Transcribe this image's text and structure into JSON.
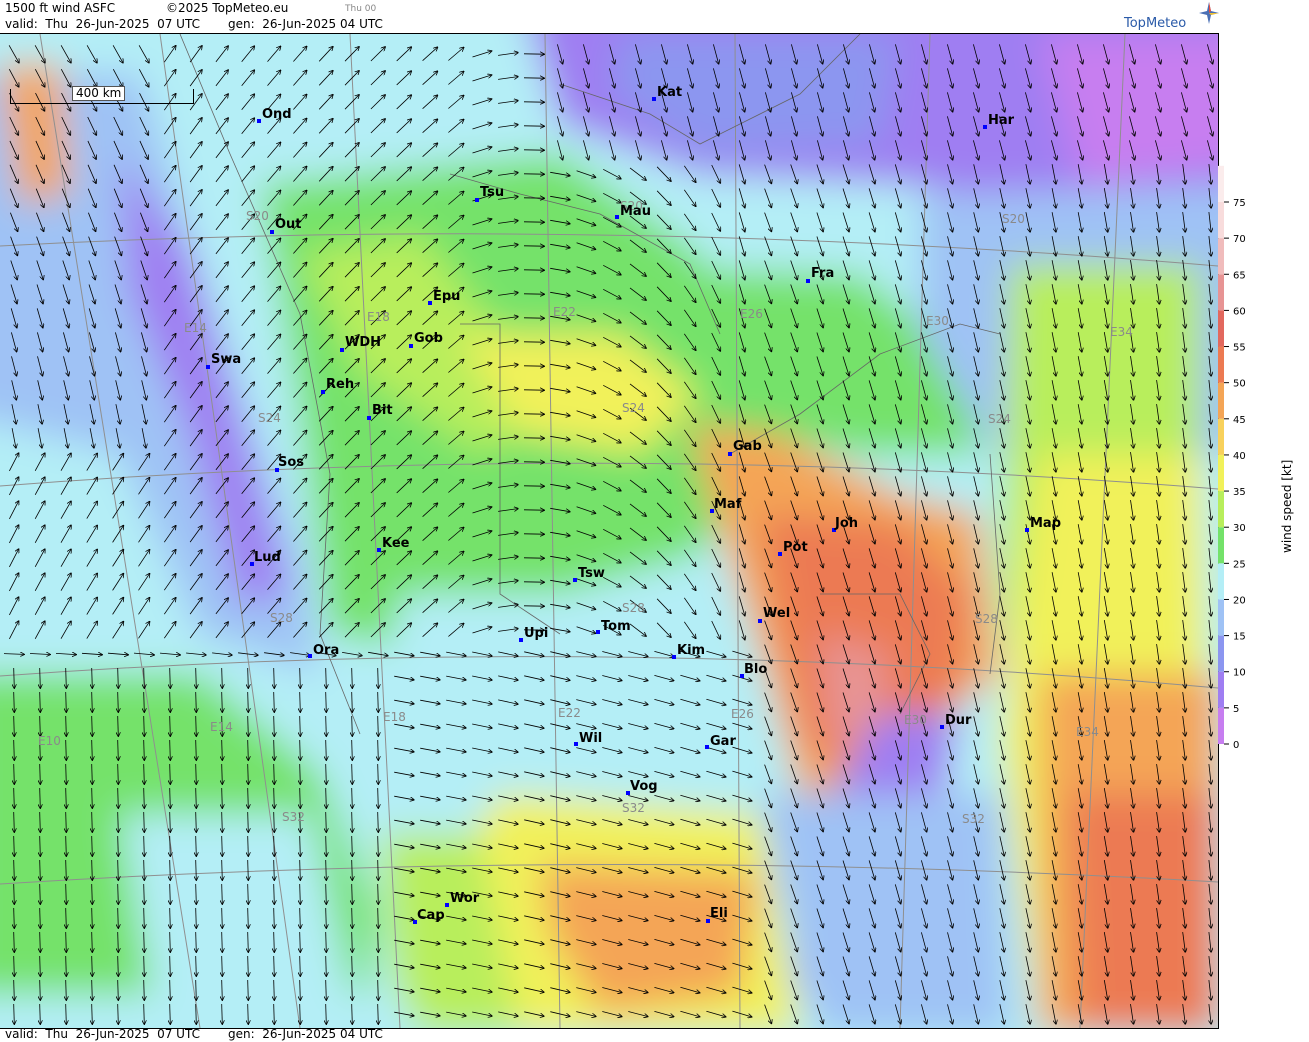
{
  "header": {
    "title": "1500 ft wind ASFC",
    "copyright": "©2025 TopMeteo.eu",
    "day_code": "Thu 00",
    "valid": "valid:  Thu  26-Jun-2025  07 UTC",
    "generated": "gen:  26-Jun-2025 04 UTC"
  },
  "footer": {
    "valid": "valid:  Thu  26-Jun-2025  07 UTC",
    "generated": "gen:  26-Jun-2025 04 UTC"
  },
  "logo": {
    "text": "TopMeteo",
    "icon": "compass-star-icon"
  },
  "map": {
    "scale_label": "400 km",
    "cities": [
      {
        "name": "Ond"
      },
      {
        "name": "Kat"
      },
      {
        "name": "Har"
      },
      {
        "name": "Tsu"
      },
      {
        "name": "Out"
      },
      {
        "name": "Mau"
      },
      {
        "name": "Fra"
      },
      {
        "name": "Epu"
      },
      {
        "name": "Gob"
      },
      {
        "name": "WDH"
      },
      {
        "name": "Swa"
      },
      {
        "name": "Reh"
      },
      {
        "name": "Bit"
      },
      {
        "name": "Gab"
      },
      {
        "name": "Sos"
      },
      {
        "name": "Maf"
      },
      {
        "name": "Joh"
      },
      {
        "name": "Map"
      },
      {
        "name": "Pot"
      },
      {
        "name": "Kee"
      },
      {
        "name": "Lud"
      },
      {
        "name": "Tsw"
      },
      {
        "name": "Wel"
      },
      {
        "name": "Upi"
      },
      {
        "name": "Tom"
      },
      {
        "name": "Ora"
      },
      {
        "name": "Kim"
      },
      {
        "name": "Blo"
      },
      {
        "name": "Dur"
      },
      {
        "name": "Wil"
      },
      {
        "name": "Gar"
      },
      {
        "name": "Vog"
      },
      {
        "name": "Wor"
      },
      {
        "name": "Cap"
      },
      {
        "name": "Eli"
      }
    ],
    "grid_labels": [
      {
        "text": "S20"
      },
      {
        "text": "S20"
      },
      {
        "text": "S20"
      },
      {
        "text": "E14"
      },
      {
        "text": "E18"
      },
      {
        "text": "E22"
      },
      {
        "text": "E26"
      },
      {
        "text": "E30"
      },
      {
        "text": "E34"
      },
      {
        "text": "S24"
      },
      {
        "text": "S24"
      },
      {
        "text": "S24"
      },
      {
        "text": "S28"
      },
      {
        "text": "S28"
      },
      {
        "text": "S28"
      },
      {
        "text": "E10"
      },
      {
        "text": "E14"
      },
      {
        "text": "E18"
      },
      {
        "text": "E22"
      },
      {
        "text": "E26"
      },
      {
        "text": "E30"
      },
      {
        "text": "E34"
      },
      {
        "text": "S32"
      },
      {
        "text": "S32"
      },
      {
        "text": "S32"
      }
    ]
  },
  "colorbar": {
    "title": "wind speed [kt]",
    "ticks": [
      "0",
      "5",
      "10",
      "15",
      "20",
      "25",
      "30",
      "35",
      "40",
      "45",
      "50",
      "55",
      "60",
      "65",
      "70",
      "75"
    ],
    "colors": [
      "#c77ef0",
      "#9f7ef2",
      "#8c96f0",
      "#9fc2f5",
      "#b4eef6",
      "#74e26a",
      "#b8ee5c",
      "#f1f15a",
      "#f8d15c",
      "#f4a556",
      "#ec7a52",
      "#e2685e",
      "#e79494",
      "#f0bcbc",
      "#f8dcdc",
      "#fbecec"
    ]
  }
}
